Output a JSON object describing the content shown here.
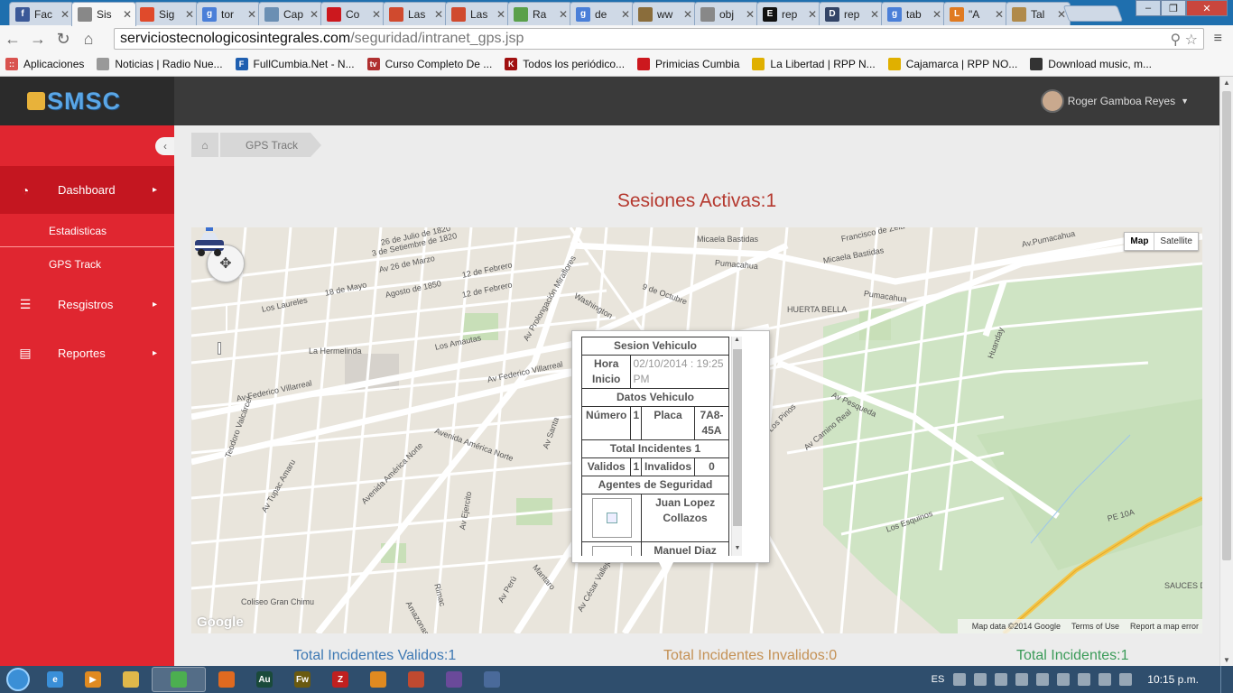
{
  "browser": {
    "tabs": [
      {
        "title": "Fac",
        "icon": "facebook-icon",
        "color": "#3b5998",
        "glyph": "f"
      },
      {
        "title": "Sis",
        "icon": "page-icon",
        "color": "#888888",
        "glyph": ""
      },
      {
        "title": "Sig",
        "icon": "microsoft-icon",
        "color": "#e04a2b",
        "glyph": ""
      },
      {
        "title": "tor",
        "icon": "google-icon",
        "color": "#4a7fd8",
        "glyph": "g"
      },
      {
        "title": "Cap",
        "icon": "image-icon",
        "color": "#6b8fb3",
        "glyph": ""
      },
      {
        "title": "Co",
        "icon": "youtube-icon",
        "color": "#cc181e",
        "glyph": ""
      },
      {
        "title": "Las",
        "icon": "git-icon",
        "color": "#d04a2e",
        "glyph": ""
      },
      {
        "title": "Las",
        "icon": "git-icon",
        "color": "#d04a2e",
        "glyph": ""
      },
      {
        "title": "Ra",
        "icon": "search-icon",
        "color": "#5aa04a",
        "glyph": ""
      },
      {
        "title": "de",
        "icon": "google-icon",
        "color": "#4a7fd8",
        "glyph": "g"
      },
      {
        "title": "ww",
        "icon": "wordpress-icon",
        "color": "#8a6d3b",
        "glyph": ""
      },
      {
        "title": "obj",
        "icon": "page-icon",
        "color": "#888888",
        "glyph": ""
      },
      {
        "title": "rep",
        "icon": "ean-icon",
        "color": "#111111",
        "glyph": "E"
      },
      {
        "title": "rep",
        "icon": "d-icon",
        "color": "#334466",
        "glyph": "D"
      },
      {
        "title": "tab",
        "icon": "google-icon",
        "color": "#4a7fd8",
        "glyph": "g"
      },
      {
        "title": "\"A",
        "icon": "l-icon",
        "color": "#e07a20",
        "glyph": "L"
      },
      {
        "title": "Tal",
        "icon": "bowl-icon",
        "color": "#b08a4a",
        "glyph": ""
      }
    ],
    "active_tab": 1,
    "url_host": "serviciostecnologicosintegrales.com",
    "url_path": "/seguridad/intranet_gps.jsp"
  },
  "bookmarks": [
    {
      "label": "Aplicaciones",
      "color": "#d9534f",
      "glyph": "::"
    },
    {
      "label": "Noticias | Radio Nue...",
      "color": "#999999",
      "glyph": ""
    },
    {
      "label": "FullCumbia.Net - N...",
      "color": "#1f5fb0",
      "glyph": "F"
    },
    {
      "label": "Curso Completo De ...",
      "color": "#b03030",
      "glyph": "tv"
    },
    {
      "label": "Todos los periódico...",
      "color": "#a01010",
      "glyph": "K"
    },
    {
      "label": "Primicias Cumbia",
      "color": "#cc181e",
      "glyph": ""
    },
    {
      "label": "La Libertad | RPP N...",
      "color": "#e0b000",
      "glyph": ""
    },
    {
      "label": "Cajamarca | RPP NO...",
      "color": "#e0b000",
      "glyph": ""
    },
    {
      "label": "Download music, m...",
      "color": "#333333",
      "glyph": ""
    }
  ],
  "app": {
    "logo": "SMSC",
    "user_name": "Roger Gamboa Reyes"
  },
  "sidebar": {
    "items": [
      {
        "label": "Dashboard",
        "icon": "dashboard-icon"
      },
      {
        "label": "Estadisticas"
      },
      {
        "label": "GPS Track"
      },
      {
        "label": "Resgistros",
        "icon": "list-icon"
      },
      {
        "label": "Reportes",
        "icon": "document-icon"
      }
    ]
  },
  "breadcrumb": {
    "current": "GPS Track"
  },
  "main": {
    "sessions_title": "Sesiones Activas:1",
    "total_valid": "Total Incidentes Validos:1",
    "total_invalid": "Total Incidentes Invalidos:0",
    "total_all": "Total Incidentes:1"
  },
  "map": {
    "type_map": "Map",
    "type_satellite": "Satellite",
    "attribution": "Map data ©2014 Google",
    "terms": "Terms of Use",
    "report": "Report a map error",
    "watermark": "Google",
    "labels": [
      "26 de Julio de 1820",
      "3 de Setiembre de 1820",
      "Av 26 de Marzo",
      "Agosto de 1850",
      "12 de Febrero",
      "18 de Mayo",
      "Los Laureles",
      "12 de Febrero",
      "Pumacahua",
      "Av.Pumacahua",
      "Pumacahua",
      "Micaela Bastidas",
      "Micaela Bastidas",
      "Francisco de Zela",
      "HUERTA BELLA",
      "Washington",
      "9 de Octubre",
      "La Hermelinda",
      "Av Federico Villarreal",
      "Av Federico Villarreal",
      "Av Prolongación Miraflores",
      "Avenida América Norte",
      "Av Pesqueda",
      "Av Tupac Amaru",
      "Avenida América Norte",
      "Coliseo Gran Chimu",
      "Av Perú",
      "Av César Vallejo",
      "PE 10A",
      "SAUCES DE BARRAZA",
      "Huanday",
      "Los Amautas",
      "Teodoro Valcárcel",
      "Av Camino Real",
      "Av Santa",
      "Av Ejercito",
      "Mantaro",
      "Amazonas",
      "Rimac",
      "Los Pinos",
      "Los Esquinos"
    ]
  },
  "infowindow": {
    "h_session": "Sesion Vehiculo",
    "hora_label": "Hora Inicio",
    "hora_value": "02/10/2014 : 19:25 PM",
    "h_vehicle": "Datos Vehiculo",
    "numero_label": "Número",
    "numero_value": "1",
    "placa_label": "Placa",
    "placa_value": "7A8-45A",
    "h_incidents": "Total Incidentes 1",
    "validos_label": "Validos",
    "validos_value": "1",
    "invalidos_label": "Invalidos",
    "invalidos_value": "0",
    "h_agents": "Agentes de Seguridad",
    "agent1": "Juan Lopez Collazos",
    "agent2": "Manuel Diaz"
  },
  "taskbar": {
    "apps": [
      {
        "name": "ie",
        "color": "#3a8fd8",
        "glyph": "e"
      },
      {
        "name": "media",
        "color": "#e08a20",
        "glyph": "▶"
      },
      {
        "name": "explorer",
        "color": "#e0b84a",
        "glyph": ""
      },
      {
        "name": "chrome",
        "color": "#4caf50",
        "glyph": ""
      },
      {
        "name": "firefox",
        "color": "#e06a20",
        "glyph": ""
      },
      {
        "name": "audition",
        "color": "#1a4a3a",
        "glyph": "Au"
      },
      {
        "name": "fireworks",
        "color": "#6a5a10",
        "glyph": "Fw"
      },
      {
        "name": "filezilla",
        "color": "#c02020",
        "glyph": "Z"
      },
      {
        "name": "folder",
        "color": "#e08a20",
        "glyph": ""
      },
      {
        "name": "app",
        "color": "#c04a30",
        "glyph": ""
      },
      {
        "name": "app2",
        "color": "#6a4a9a",
        "glyph": ""
      },
      {
        "name": "app3",
        "color": "#4a6a9a",
        "glyph": ""
      }
    ],
    "lang": "ES",
    "clock": "10:15 p.m."
  }
}
